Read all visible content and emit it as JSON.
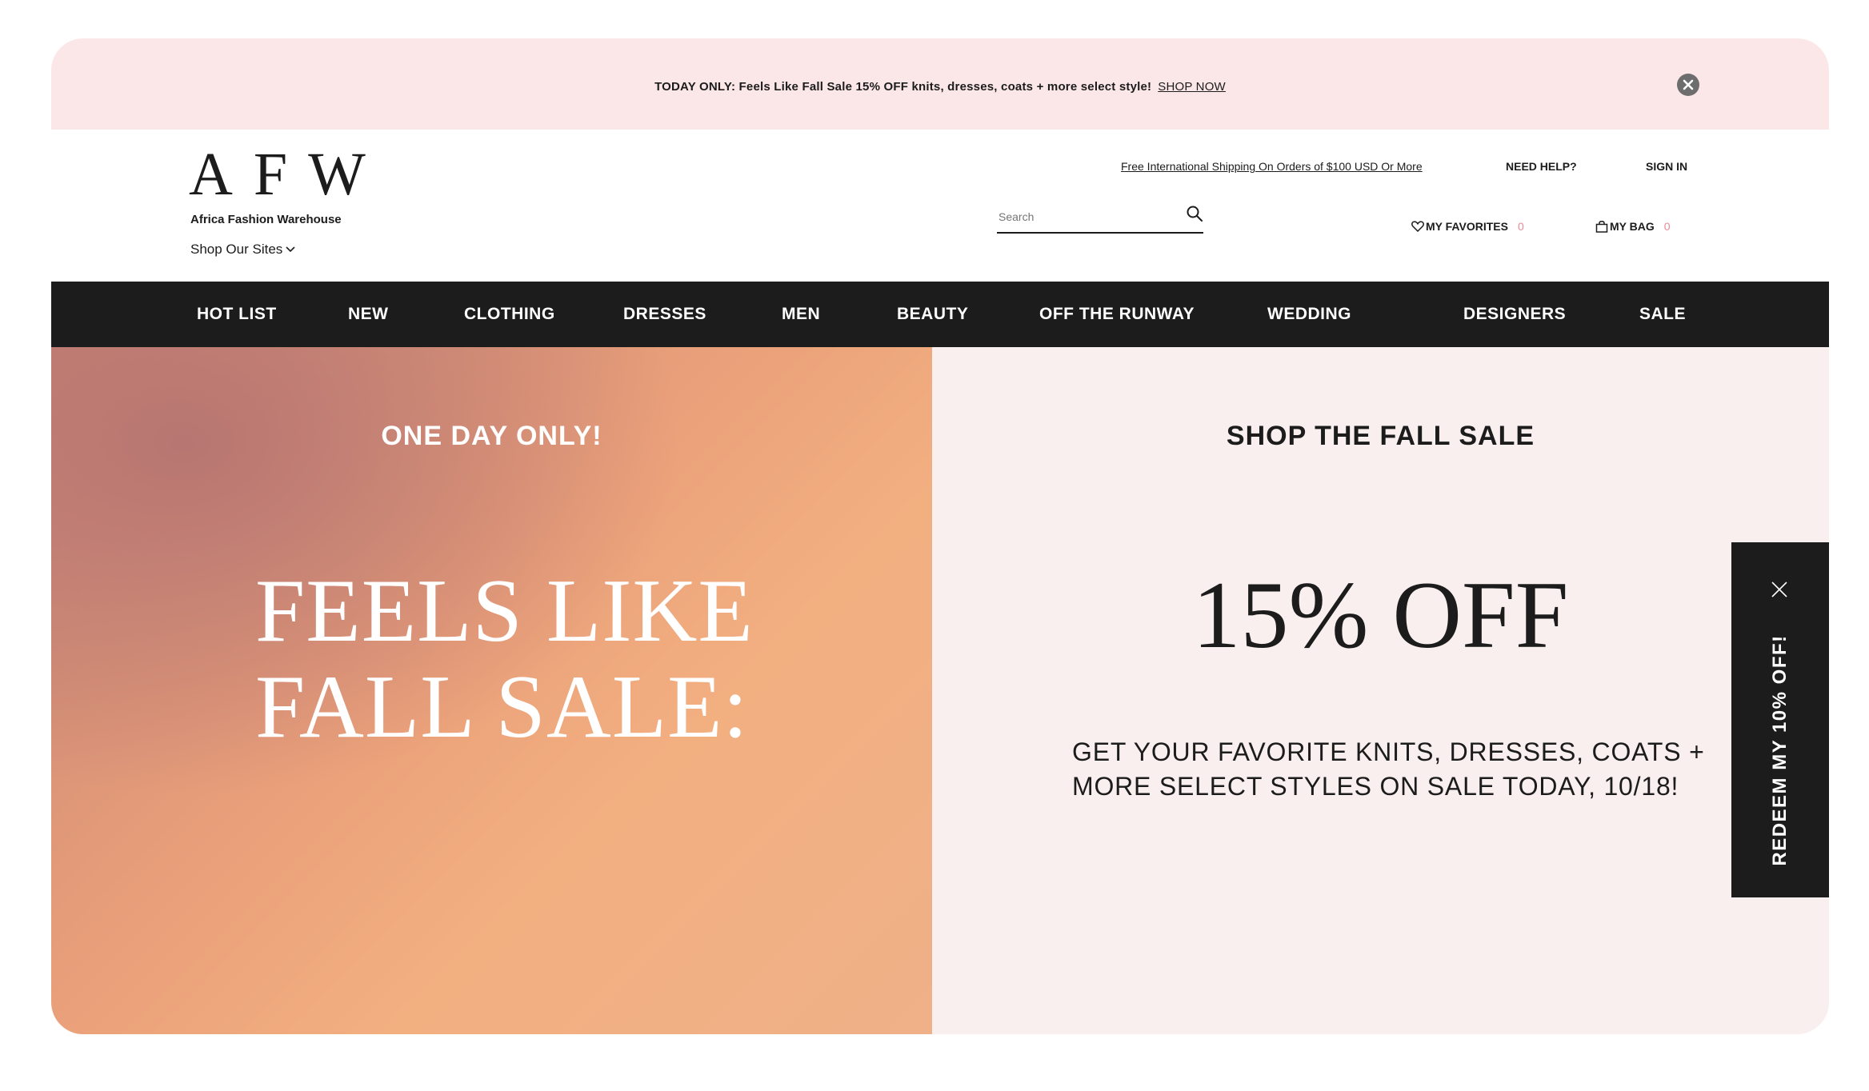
{
  "promo": {
    "text": "TODAY ONLY: Feels Like Fall Sale 15% OFF knits, dresses, coats + more select style!",
    "link": "SHOP NOW"
  },
  "header": {
    "logo": "AFW",
    "logo_subtitle": "Africa Fashion Warehouse",
    "shop_sites": "Shop Our Sites",
    "shipping_link": "Free International Shipping On Orders of $100 USD Or More",
    "need_help": "NEED HELP?",
    "sign_in": "SIGN IN",
    "search": {
      "placeholder": "Search"
    },
    "favorites": {
      "label": "MY FAVORITES",
      "count": "0"
    },
    "bag": {
      "label": "MY BAG",
      "count": "0"
    }
  },
  "nav": {
    "items": [
      {
        "label": "HOT LIST"
      },
      {
        "label": "NEW"
      },
      {
        "label": "CLOTHING"
      },
      {
        "label": "DRESSES"
      },
      {
        "label": "MEN"
      },
      {
        "label": "BEAUTY"
      },
      {
        "label": "OFF THE RUNWAY"
      },
      {
        "label": "WEDDING"
      },
      {
        "label": "DESIGNERS"
      },
      {
        "label": "SALE"
      }
    ]
  },
  "hero": {
    "left": {
      "eyebrow": "ONE DAY ONLY!",
      "headline": "FEELS LIKE\nFALL SALE:"
    },
    "right": {
      "eyebrow": "SHOP THE FALL SALE",
      "headline": "15% OFF",
      "body": "GET YOUR FAVORITE KNITS, DRESSES, COATS + MORE SELECT STYLES ON SALE TODAY, 10/18!"
    }
  },
  "redeem_tab": {
    "label": "REDEEM MY 10% OFF!"
  },
  "colors": {
    "promo_bg": "#fbe7e7",
    "nav_bg": "#1c1c1c",
    "hero_right_bg": "#f9efee",
    "count_accent": "#e88a9a"
  }
}
